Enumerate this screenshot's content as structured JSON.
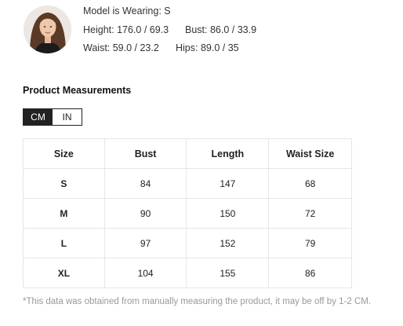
{
  "model": {
    "wearing": "Model is Wearing: S",
    "height": "Height: 176.0 / 69.3",
    "bust": "Bust: 86.0 / 33.9",
    "waist": "Waist: 59.0 / 23.2",
    "hips": "Hips: 89.0 / 35"
  },
  "section_title": "Product Measurements",
  "units": {
    "cm": "CM",
    "in": "IN",
    "selected": "CM"
  },
  "table": {
    "headers": [
      "Size",
      "Bust",
      "Length",
      "Waist Size"
    ],
    "rows": [
      [
        "S",
        "84",
        "147",
        "68"
      ],
      [
        "M",
        "90",
        "150",
        "72"
      ],
      [
        "L",
        "97",
        "152",
        "79"
      ],
      [
        "XL",
        "104",
        "155",
        "86"
      ]
    ]
  },
  "note": "*This data was obtained from manually measuring the product, it may be off by 1-2 CM."
}
